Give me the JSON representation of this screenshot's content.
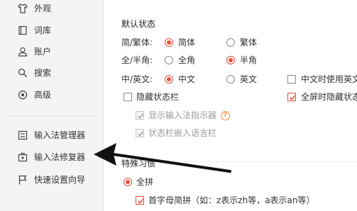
{
  "sidebar": {
    "items": [
      {
        "label": "外观",
        "icon": "shirt-icon"
      },
      {
        "label": "词库",
        "icon": "book-icon"
      },
      {
        "label": "账户",
        "icon": "user-icon"
      },
      {
        "label": "搜索",
        "icon": "search-icon"
      },
      {
        "label": "高级",
        "icon": "advanced-icon"
      },
      {
        "label": "输入法管理器",
        "icon": "manager-icon"
      },
      {
        "label": "输入法修复器",
        "icon": "repair-icon"
      },
      {
        "label": "快速设置向导",
        "icon": "flag-icon"
      }
    ]
  },
  "default_state": {
    "title": "默认状态",
    "rows": [
      {
        "label": "简/繁体:",
        "options": [
          {
            "label": "简体",
            "checked": true
          },
          {
            "label": "繁体",
            "checked": false
          }
        ]
      },
      {
        "label": "全/半角:",
        "options": [
          {
            "label": "全角",
            "checked": false
          },
          {
            "label": "半角",
            "checked": true
          }
        ]
      },
      {
        "label": "中/英文:",
        "options": [
          {
            "label": "中文",
            "checked": true
          },
          {
            "label": "英文",
            "checked": false
          }
        ]
      }
    ],
    "cn_use_en_punct": {
      "label": "中文时使用英文",
      "checked": false
    },
    "hide_status_bar": {
      "label": "隐藏状态栏",
      "checked": false
    },
    "fullscreen_hide": {
      "label": "全屏时隐藏状态",
      "checked": true
    },
    "show_indicator": {
      "label": "显示输入法指示器",
      "checked": true,
      "help": "?"
    },
    "embed_langbar": {
      "label": "状态栏嵌入语言栏",
      "checked": true
    }
  },
  "special_habits": {
    "title": "特殊习惯",
    "full_pinyin": {
      "label": "全拼",
      "checked": true
    },
    "initials": {
      "label": "首字母简拼（如：z表示zh等，a表示an等）",
      "checked": true
    }
  },
  "colors": {
    "accent": "#e8533d",
    "sidebar_bg": "#f4f4f6",
    "arrow": "#111111"
  }
}
